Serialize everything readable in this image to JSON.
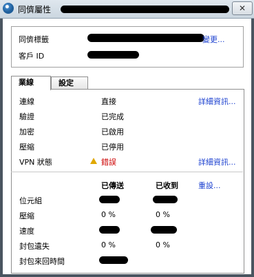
{
  "window": {
    "title": "同儕屬性",
    "close_glyph": "✕"
  },
  "identity": {
    "peer_name_label": "同儕標籤",
    "change_link": "變更...",
    "client_id_label": "客戶 ID"
  },
  "tabs": [
    {
      "label": "業線",
      "active": true
    },
    {
      "label": "設定",
      "active": false
    }
  ],
  "status": {
    "rows": [
      {
        "label": "連線",
        "value": "直接"
      },
      {
        "label": "驗證",
        "value": "已完成"
      },
      {
        "label": "加密",
        "value": "已啟用"
      },
      {
        "label": "壓縮",
        "value": "已停用"
      },
      {
        "label": "VPN 狀態",
        "value": "錯誤"
      }
    ],
    "details_link": "詳細資訊...",
    "vpn_details_link": "詳細資訊...",
    "warning_icon": "warning-triangle-icon"
  },
  "traffic": {
    "header_sent": "已傳送",
    "header_received": "已收到",
    "reset_link": "重設...",
    "rows": [
      {
        "label": "位元組",
        "sent": "",
        "received": ""
      },
      {
        "label": "壓縮",
        "sent": "0 %",
        "received": "0 %"
      },
      {
        "label": "速度",
        "sent": "",
        "received": ""
      },
      {
        "label": "封包遺失",
        "sent": "0 %",
        "received": "0 %"
      },
      {
        "label": "封包來回時間",
        "sent": "",
        "received": ""
      }
    ]
  },
  "colors": {
    "link": "#1a3fcf",
    "error": "#cc0000",
    "warning": "#e0a800"
  }
}
